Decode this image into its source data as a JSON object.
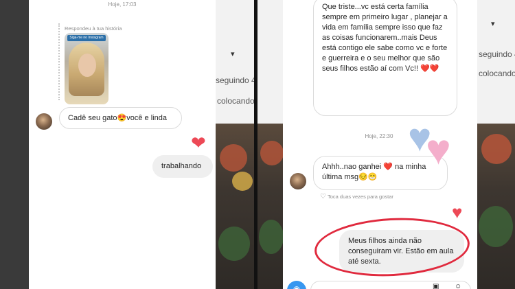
{
  "background": {
    "mid_text_1": "seguindo 4",
    "mid_text_2": "colocando o",
    "right_text_1": "seguindo 4",
    "right_text_2": "colocando o"
  },
  "left_panel": {
    "timestamp": "Hoje, 17:03",
    "reply_label": "Respondeu à tua história",
    "story_caption": "Siga-me no Instagram",
    "message_received": "Cadê seu gato😍você e linda",
    "reaction": "❤",
    "message_sent": "trabalhando"
  },
  "right_panel": {
    "message_received_1": "Que triste...vc está certa família sempre em primeiro lugar , planejar a vida em família sempre isso que faz as coisas funcionarem..mais Deus está contigo ele sabe como vc e forte e guerreira e o seu melhor que são seus filhos estão aí com Vc!! ❤️❤️",
    "timestamp": "Hoje, 22:30",
    "message_received_2_a": "Ahhh..nao ganhei",
    "message_received_2_heart": "❤️",
    "message_received_2_b": "na minha última msg😔😁",
    "like_hint": "Toca duas vezes para gostar",
    "message_sent": "Meus filhos ainda não conseguiram vir. Estão em aula até sexta."
  },
  "colors": {
    "accent_red": "#ed4956",
    "circle_red": "#e02a3e",
    "bubble_border": "#dbdbdb",
    "bubble_gray": "#efefef",
    "muted_text": "#8e8e8e",
    "heart_blue": "#a8c3e6",
    "heart_pink": "#f4aecb"
  },
  "icons": {
    "camera": "camera-icon",
    "heart": "heart-icon",
    "image": "image-icon",
    "sticker": "sticker-icon"
  }
}
